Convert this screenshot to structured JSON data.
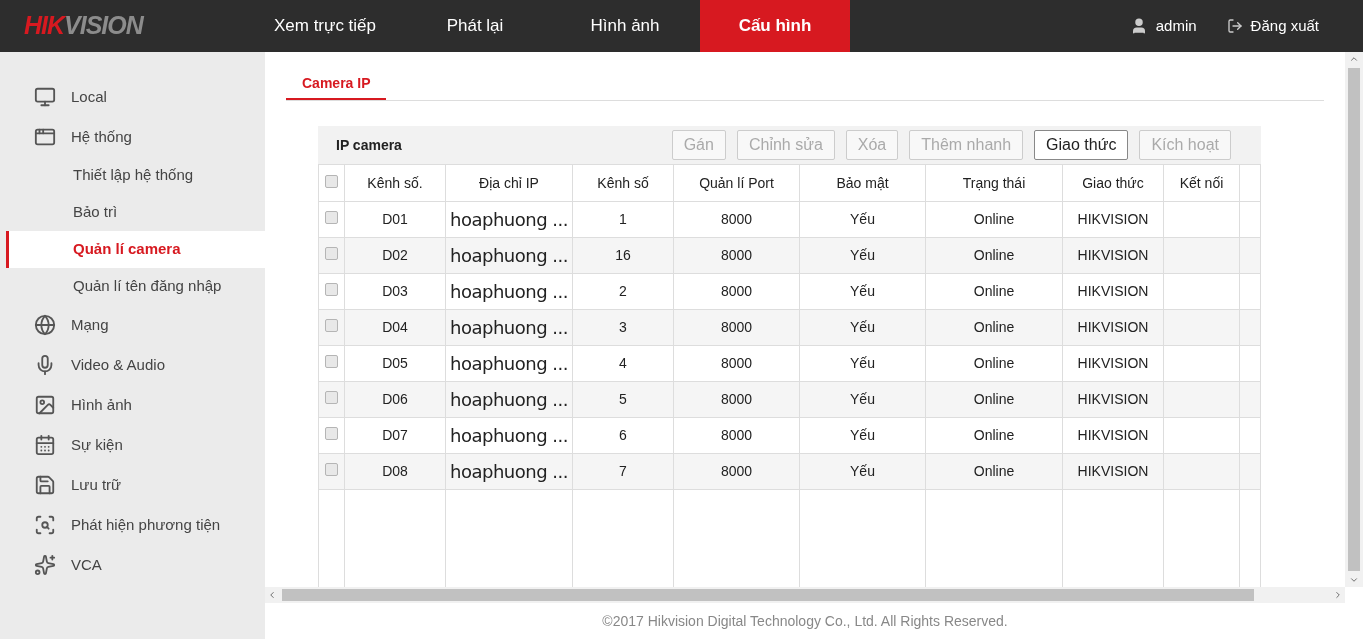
{
  "header": {
    "logo": [
      "HIK",
      "VISION"
    ],
    "nav": [
      {
        "label": "Xem trực tiếp",
        "selected": false
      },
      {
        "label": "Phát lại",
        "selected": false
      },
      {
        "label": "Hình ảnh",
        "selected": false
      },
      {
        "label": "Cấu hình",
        "selected": true
      }
    ],
    "user": "admin",
    "logout": "Đăng xuất"
  },
  "sidebar": {
    "items": [
      {
        "label": "Local",
        "selected": false
      },
      {
        "label": "Hệ thống",
        "selected": false,
        "children": [
          {
            "label": "Thiết lập hệ thống",
            "selected": false
          },
          {
            "label": "Bảo trì",
            "selected": false
          },
          {
            "label": "Quản lí camera",
            "selected": true
          },
          {
            "label": "Quản lí tên đăng nhập",
            "selected": false
          }
        ]
      },
      {
        "label": "Mạng",
        "selected": false
      },
      {
        "label": "Video & Audio",
        "selected": false
      },
      {
        "label": "Hình ảnh",
        "selected": false
      },
      {
        "label": "Sự kiện",
        "selected": false
      },
      {
        "label": "Lưu trữ",
        "selected": false
      },
      {
        "label": "Phát hiện phương tiện",
        "selected": false
      },
      {
        "label": "VCA",
        "selected": false
      }
    ]
  },
  "tabs": [
    {
      "label": "Camera IP",
      "selected": true
    }
  ],
  "panel": {
    "title": "IP camera",
    "buttons": [
      {
        "label": "Gán",
        "disabled": true
      },
      {
        "label": "Chỉnh sửa",
        "disabled": true
      },
      {
        "label": "Xóa",
        "disabled": true
      },
      {
        "label": "Thêm nhanh",
        "disabled": true
      },
      {
        "label": "Giao thức",
        "disabled": false
      },
      {
        "label": "Kích hoạt",
        "disabled": true
      }
    ]
  },
  "table": {
    "header_checked": false,
    "columns": [
      "Kênh số.",
      "Địa chỉ IP",
      "Kênh số",
      "Quản lí Port",
      "Bảo mật",
      "Trạng thái",
      "Giao thức",
      "Kết nối"
    ],
    "rows": [
      {
        "checked": false,
        "cells": [
          "D01",
          "hoaphuong ...",
          "1",
          "8000",
          "Yếu",
          "Online",
          "HIKVISION"
        ]
      },
      {
        "checked": false,
        "cells": [
          "D02",
          "hoaphuong ...",
          "16",
          "8000",
          "Yếu",
          "Online",
          "HIKVISION"
        ]
      },
      {
        "checked": false,
        "cells": [
          "D03",
          "hoaphuong ...",
          "2",
          "8000",
          "Yếu",
          "Online",
          "HIKVISION"
        ]
      },
      {
        "checked": false,
        "cells": [
          "D04",
          "hoaphuong ...",
          "3",
          "8000",
          "Yếu",
          "Online",
          "HIKVISION"
        ]
      },
      {
        "checked": false,
        "cells": [
          "D05",
          "hoaphuong ...",
          "4",
          "8000",
          "Yếu",
          "Online",
          "HIKVISION"
        ]
      },
      {
        "checked": false,
        "cells": [
          "D06",
          "hoaphuong ...",
          "5",
          "8000",
          "Yếu",
          "Online",
          "HIKVISION"
        ]
      },
      {
        "checked": false,
        "cells": [
          "D07",
          "hoaphuong ...",
          "6",
          "8000",
          "Yếu",
          "Online",
          "HIKVISION"
        ]
      },
      {
        "checked": false,
        "cells": [
          "D08",
          "hoaphuong ...",
          "7",
          "8000",
          "Yếu",
          "Online",
          "HIKVISION"
        ]
      }
    ]
  },
  "footer": "©2017 Hikvision Digital Technology Co., Ltd. All Rights Reserved."
}
